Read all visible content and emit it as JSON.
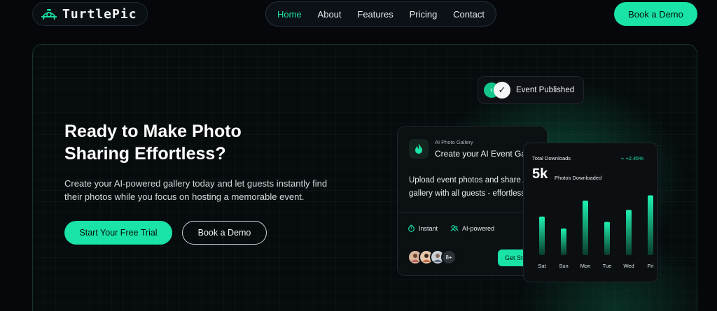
{
  "brand": {
    "name": "TurtlePic"
  },
  "nav": {
    "items": [
      {
        "label": "Home",
        "active": true
      },
      {
        "label": "About",
        "active": false
      },
      {
        "label": "Features",
        "active": false
      },
      {
        "label": "Pricing",
        "active": false
      },
      {
        "label": "Contact",
        "active": false
      }
    ],
    "cta_label": "Book a Demo"
  },
  "hero": {
    "headline": "Ready to Make Photo Sharing Effortless?",
    "subtext": "Create your AI-powered gallery today and let guests instantly find their photos while you focus on hosting a memorable event.",
    "primary_button": "Start Your Free Trial",
    "secondary_button": "Book a Demo"
  },
  "event_badge": {
    "label": "Event Published"
  },
  "gallery_card": {
    "kicker": "AI Photo Gallery",
    "title": "Create your AI Event Gallery",
    "body_line1": "Upload event photos and share AI",
    "body_line2": "gallery with all guests - effortless",
    "feature_instant": "Instant",
    "feature_ai": "AI-powered",
    "avatar_more": "8+",
    "button_label": "Get Started"
  },
  "downloads_card": {
    "title": "Total Downloads",
    "change": "+2.45%",
    "big_number": "5k",
    "big_caption": "Photos Downloaded"
  },
  "colors": {
    "accent": "#19e3a6",
    "background": "#05070b"
  },
  "chart_data": {
    "type": "bar",
    "categories": [
      "Sat",
      "Sun",
      "Mon",
      "Tue",
      "Wed",
      "Fri"
    ],
    "values": [
      58,
      40,
      82,
      50,
      68,
      90
    ],
    "ylim": [
      0,
      100
    ]
  }
}
